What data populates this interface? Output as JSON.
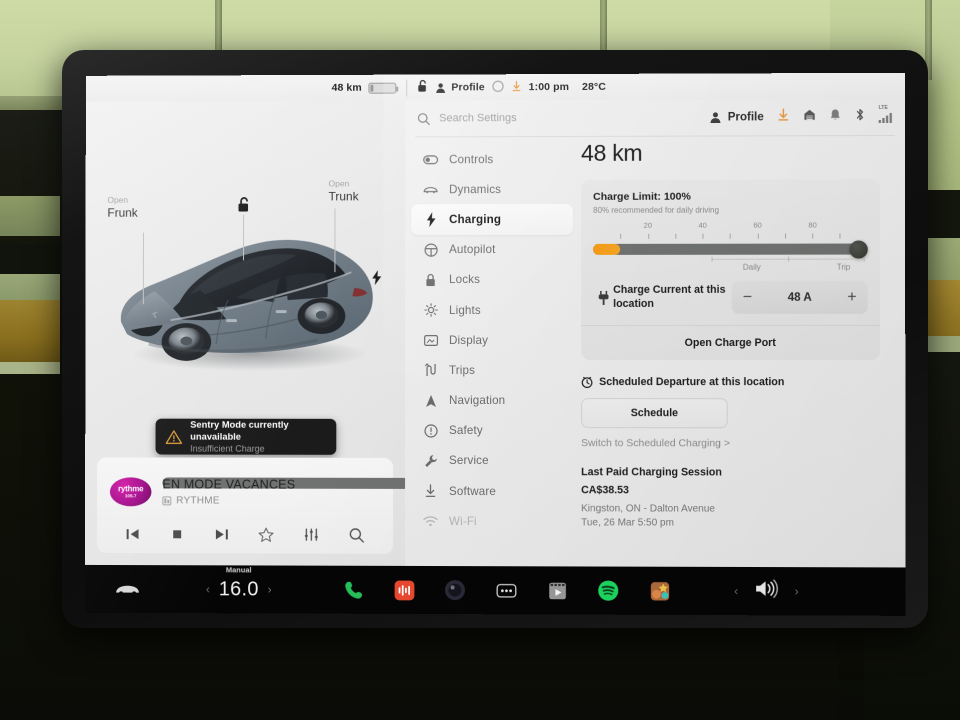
{
  "status_bar": {
    "range": "48 km",
    "battery_icon": "battery-low-icon",
    "lock_icon": "unlock-icon",
    "profile_icon": "person-icon",
    "profile_label": "Profile",
    "circle_icon": "circle-icon",
    "download_icon": "download-arrow-icon",
    "time": "1:00 pm",
    "temperature": "28°C"
  },
  "car_view": {
    "frunk_small": "Open",
    "frunk_label": "Frunk",
    "trunk_small": "Open",
    "trunk_label": "Trunk",
    "lock_icon": "unlock-icon",
    "charge_port_icon": "charge-bolt-icon",
    "car_image": "tesla-model-y-grey"
  },
  "toast": {
    "icon": "warning-triangle-icon",
    "title": "Sentry Mode currently unavailable",
    "subtitle": "Insufficient Charge"
  },
  "media_player": {
    "station_logo_line1": "rythme",
    "station_logo_line2": "105.7",
    "track": "EN MODE VACANCES",
    "source_icon": "radio-icon",
    "artist": "RYTHME",
    "controls": [
      {
        "name": "previous-track-button",
        "icon": "previous-icon"
      },
      {
        "name": "stop-button",
        "icon": "stop-icon"
      },
      {
        "name": "next-track-button",
        "icon": "next-icon"
      },
      {
        "name": "favorite-button",
        "icon": "star-icon"
      },
      {
        "name": "equalizer-button",
        "icon": "sliders-icon"
      },
      {
        "name": "search-media-button",
        "icon": "search-icon"
      }
    ]
  },
  "settings_header": {
    "search_icon": "search-icon",
    "search_placeholder": "Search Settings",
    "profile_icon": "person-icon",
    "profile_label": "Profile",
    "icons": [
      "download-arrow-icon",
      "home-garage-icon",
      "bell-icon",
      "bluetooth-icon",
      "lte-signal-icon"
    ]
  },
  "sidebar": {
    "items": [
      {
        "label": "Controls",
        "icon": "toggle-icon",
        "selected": false,
        "dim": false
      },
      {
        "label": "Dynamics",
        "icon": "car-icon",
        "selected": false,
        "dim": false
      },
      {
        "label": "Charging",
        "icon": "bolt-icon",
        "selected": true,
        "dim": false
      },
      {
        "label": "Autopilot",
        "icon": "steering-wheel-icon",
        "selected": false,
        "dim": false
      },
      {
        "label": "Locks",
        "icon": "lock-icon",
        "selected": false,
        "dim": false
      },
      {
        "label": "Lights",
        "icon": "sun-icon",
        "selected": false,
        "dim": false
      },
      {
        "label": "Display",
        "icon": "screen-icon",
        "selected": false,
        "dim": false
      },
      {
        "label": "Trips",
        "icon": "road-icon",
        "selected": false,
        "dim": false
      },
      {
        "label": "Navigation",
        "icon": "compass-arrow-icon",
        "selected": false,
        "dim": false
      },
      {
        "label": "Safety",
        "icon": "alert-circle-icon",
        "selected": false,
        "dim": false
      },
      {
        "label": "Service",
        "icon": "wrench-icon",
        "selected": false,
        "dim": false
      },
      {
        "label": "Software",
        "icon": "download-arrow-icon",
        "selected": false,
        "dim": false
      },
      {
        "label": "Wi-Fi",
        "icon": "wifi-icon",
        "selected": false,
        "dim": true
      }
    ]
  },
  "charging": {
    "range": "48 km",
    "charge_limit_title": "Charge Limit: 100%",
    "charge_limit_subtitle": "80% recommended for daily driving",
    "slider": {
      "current_charge_percent": 10,
      "limit_percent": 100,
      "tick_labels": [
        "20",
        "40",
        "60",
        "80"
      ],
      "daily_label": "Daily",
      "trip_label": "Trip",
      "fill_color": "#f5a623",
      "track_color": "#6f7270",
      "knob_color": "#3a3d36"
    },
    "charge_current": {
      "icon": "plug-icon",
      "label": "Charge Current at this location",
      "minus": "−",
      "value": "48 A",
      "plus": "+"
    },
    "open_charge_port": "Open Charge Port",
    "scheduled_departure": {
      "icon": "clock-icon",
      "label": "Scheduled Departure at this location",
      "button": "Schedule",
      "switch_link": "Switch to Scheduled Charging >"
    },
    "last_session": {
      "title": "Last Paid Charging Session",
      "amount": "CA$38.53",
      "location": "Kingston, ON - Dalton Avenue",
      "datetime": "Tue, 26 Mar 5:50 pm"
    }
  },
  "dock": {
    "car_icon": "car-icon",
    "climate": {
      "mode": "Manual",
      "temperature": "16.0",
      "left_chevron": "‹",
      "right_chevron": "›"
    },
    "apps": [
      {
        "name": "phone-app-icon",
        "icon": "phone-icon",
        "color": "#25c05a"
      },
      {
        "name": "media-app-icon",
        "icon": "equalizer-icon",
        "color": "#e8492f"
      },
      {
        "name": "camera-app-icon",
        "icon": "camera-icon",
        "color": "#2a2a38"
      },
      {
        "name": "more-apps-icon",
        "icon": "ellipsis-icon",
        "color": "#1a1a1a"
      },
      {
        "name": "theater-app-icon",
        "icon": "film-icon",
        "color": "#8a8a8a"
      },
      {
        "name": "spotify-app-icon",
        "icon": "spotify-icon",
        "color": "#1ed760"
      },
      {
        "name": "arcade-app-icon",
        "icon": "arcade-icon",
        "color": "#d08a3a"
      }
    ],
    "volume": {
      "left_chevron": "‹",
      "icon": "speaker-icon",
      "right_chevron": "›"
    }
  }
}
